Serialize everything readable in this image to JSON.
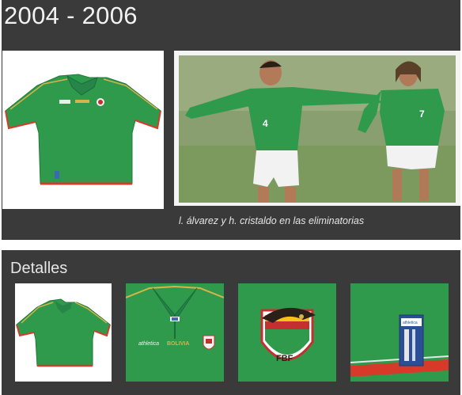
{
  "header": {
    "title": "2004 - 2006"
  },
  "main_photo": {
    "caption": "l. álvarez y h. cristaldo en las eliminatorias"
  },
  "details": {
    "title": "Detalles"
  },
  "colors": {
    "panel": "#3a3a3a",
    "shirt_green": "#2f9a4c",
    "trim_red": "#d83a2a",
    "trim_gold": "#d8b24a"
  },
  "logos": {
    "brand": "athletica",
    "team": "BOLIVIA",
    "federation": "FBF"
  },
  "player_numbers": {
    "left": "4",
    "right": "7"
  }
}
